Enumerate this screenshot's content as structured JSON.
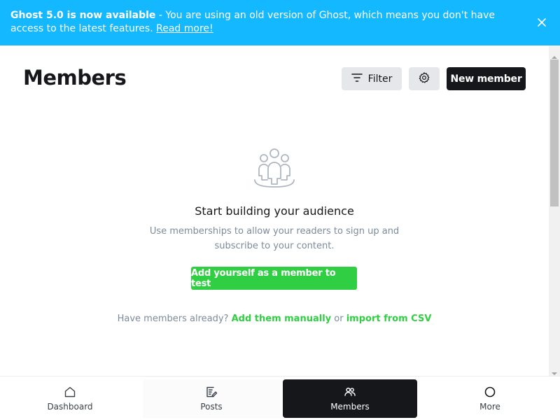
{
  "banner": {
    "strong": "Ghost 5.0 is now available",
    "text": " - You are using an old version of Ghost, which means you don't have access to the latest features. ",
    "link": "Read more!"
  },
  "header": {
    "title": "Members",
    "filter_label": "Filter",
    "new_member_label": "New member"
  },
  "empty_state": {
    "title": "Start building your audience",
    "description": "Use memberships to allow your readers to sign up and subscribe to your content.",
    "cta": "Add yourself as a member to test",
    "prompt": "Have members already?",
    "link_manual": "Add them manually",
    "or": "or",
    "link_import": "import from CSV"
  },
  "nav": [
    {
      "label": "Dashboard",
      "icon": "home-icon"
    },
    {
      "label": "Posts",
      "icon": "edit-icon"
    },
    {
      "label": "Members",
      "icon": "members-icon",
      "active": true
    },
    {
      "label": "More",
      "icon": "circle-icon"
    }
  ],
  "colors": {
    "banner": "#14b8ff",
    "accent_green": "#30cf43",
    "dark": "#15171a",
    "muted": "#7c8b9a"
  }
}
